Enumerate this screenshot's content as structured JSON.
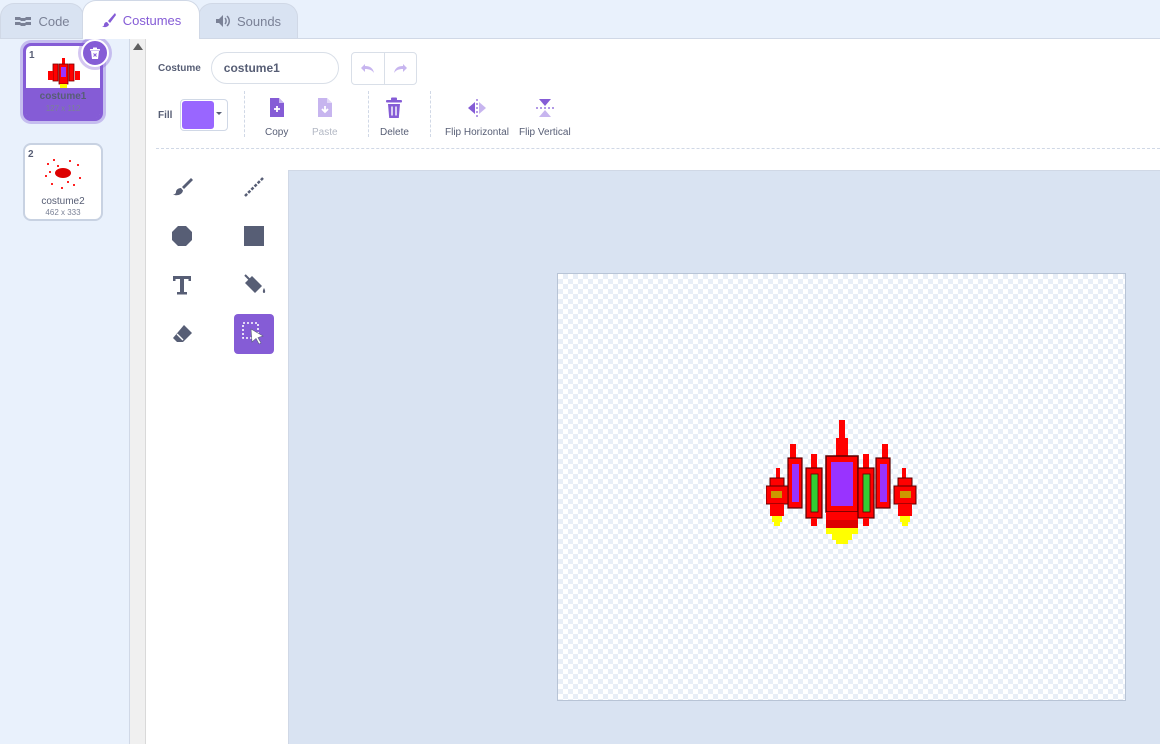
{
  "tabs": [
    {
      "label": "Code",
      "icon": "code-icon",
      "active": false
    },
    {
      "label": "Costumes",
      "icon": "brush-icon",
      "active": true
    },
    {
      "label": "Sounds",
      "icon": "speaker-icon",
      "active": false
    }
  ],
  "costumes": [
    {
      "number": "1",
      "name": "costume1",
      "size": "127 x 112",
      "selected": true
    },
    {
      "number": "2",
      "name": "costume2",
      "size": "462 x 333",
      "selected": false
    }
  ],
  "editor": {
    "costume_label": "Costume",
    "costume_name": "costume1",
    "fill_label": "Fill",
    "fill_color": "#9966ff",
    "buttons": {
      "copy": "Copy",
      "paste": "Paste",
      "delete": "Delete",
      "flip_horizontal": "Flip Horizontal",
      "flip_vertical": "Flip Vertical"
    }
  },
  "tools": [
    "brush-icon",
    "line-icon",
    "circle-icon",
    "rectangle-icon",
    "text-icon",
    "fill-bucket-icon",
    "eraser-icon",
    "select-icon"
  ],
  "active_tool": "select-icon",
  "colors": {
    "accent": "#855cd6",
    "background": "#e9f1fc",
    "text": "#575e75"
  }
}
